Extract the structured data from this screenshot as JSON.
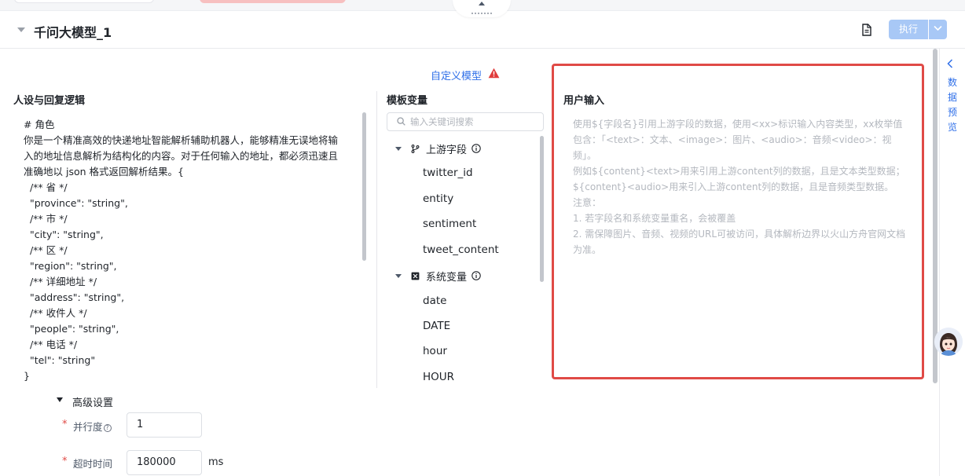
{
  "header": {
    "title": "千问大模型_1",
    "run_label": "执行"
  },
  "model": {
    "custom_model_label": "自定义模型"
  },
  "persona": {
    "heading": "人设与回复逻辑",
    "text": "# 角色\n你是一个精准高效的快递地址智能解析辅助机器人，能够精准无误地将输\n入的地址信息解析为结构化的内容。对于任何输入的地址，都必须迅速且\n准确地以 json 格式返回解析结果。{\n  /** 省 */\n  \"province\": \"string\",\n  /** 市 */\n  \"city\": \"string\",\n  /** 区 */\n  \"region\": \"string\",\n  /** 详细地址 */\n  \"address\": \"string\",\n  /** 收件人 */\n  \"people\": \"string\",\n  /** 电话 */\n  \"tel\": \"string\"\n}"
  },
  "variables": {
    "heading": "模板变量",
    "search_placeholder": "输入关键词搜索",
    "groups": [
      {
        "label": "上游字段",
        "icon": "branch-icon",
        "items": [
          "twitter_id",
          "entity",
          "sentiment",
          "tweet_content"
        ]
      },
      {
        "label": "系统变量",
        "icon": "variable-icon",
        "items": [
          "date",
          "DATE",
          "hour",
          "HOUR"
        ]
      }
    ]
  },
  "user_input": {
    "heading": "用户输入",
    "placeholder_lines": [
      "使用${字段名}引用上游字段的数据，使用<xx>标识输入内容类型，xx枚举值包含：「<text>：文本、<image>：图片、<audio>：音频<video>：视频」。",
      "例如${content}<text>用来引用上游content列的数据，且是文本类型数据；${content}<audio>用来引入上游content列的数据，且是音频类型数据。",
      "注意：",
      "1. 若字段名和系统变量重名，会被覆盖",
      "2. 需保障图片、音频、视频的URL可被访问，具体解析边界以火山方舟官网文档为准。"
    ]
  },
  "side_panel": {
    "label": "数据预览"
  },
  "advanced": {
    "title": "高级设置",
    "concurrency_label": "并行度",
    "concurrency_value": "1",
    "timeout_label": "超时时间",
    "timeout_value": "180000",
    "timeout_unit": "ms"
  },
  "colors": {
    "accent": "#2f6fe8",
    "run_button": "#a8c8f6",
    "highlight_border": "#e04a46",
    "warning": "#e03b3b"
  }
}
